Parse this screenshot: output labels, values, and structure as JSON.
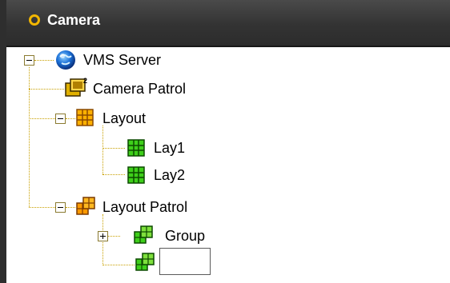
{
  "panel": {
    "title": "Camera",
    "accent": "#f2b600",
    "header_bg": "#333333"
  },
  "tree": {
    "root": {
      "label": "VMS Server",
      "icon": "globe-server-icon",
      "expanded": true
    },
    "camera_patrol": {
      "label": "Camera Patrol",
      "icon": "camera-patrol-icon"
    },
    "layout": {
      "label": "Layout",
      "icon": "layout-grid-icon",
      "expanded": true
    },
    "layout_children": [
      {
        "label": "Lay1",
        "icon": "layout-green-icon"
      },
      {
        "label": "Lay2",
        "icon": "layout-green-icon"
      }
    ],
    "layout_patrol": {
      "label": "Layout Patrol",
      "icon": "layout-patrol-icon",
      "expanded": true
    },
    "layout_patrol_children": [
      {
        "label": "Group",
        "icon": "layout-group-icon",
        "expanded": false
      },
      {
        "label": "",
        "icon": "layout-group-icon",
        "editing": true,
        "edit_value": ""
      }
    ]
  }
}
